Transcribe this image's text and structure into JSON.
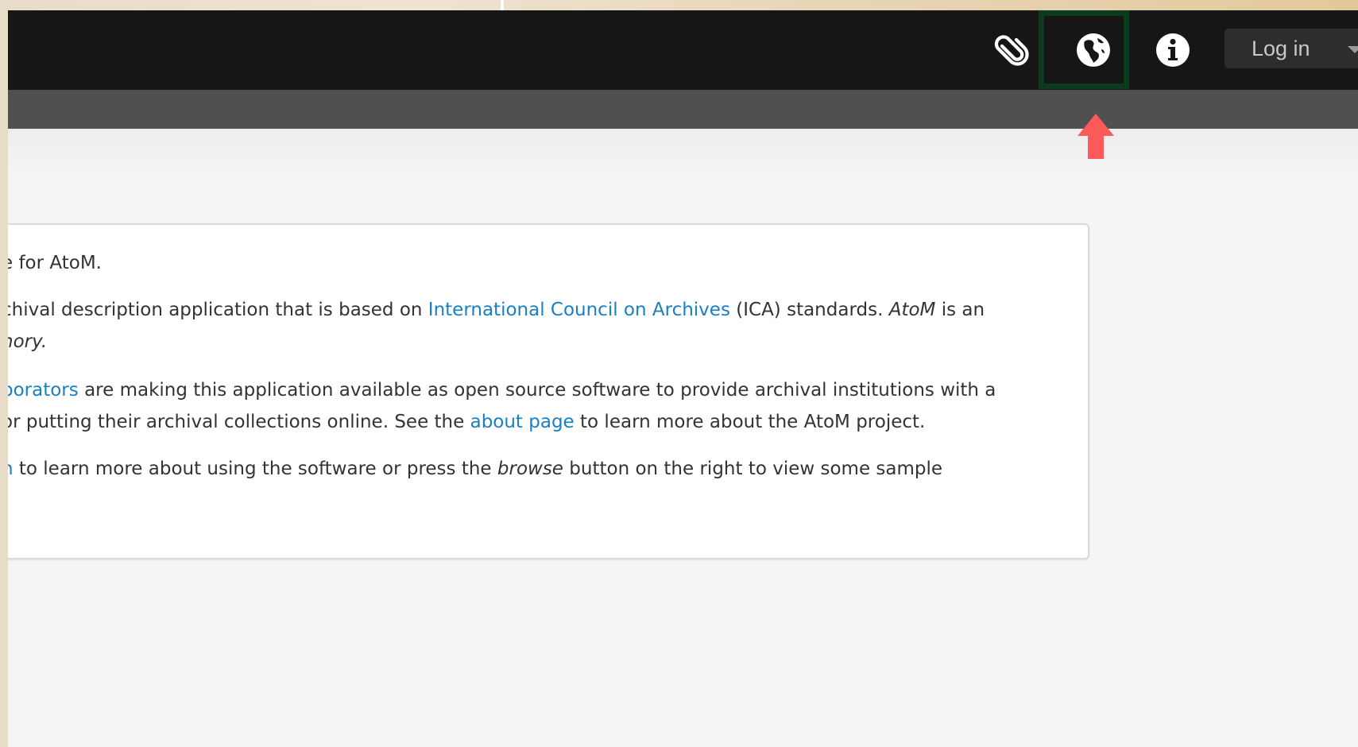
{
  "header": {
    "login_label": "Log in",
    "icons": {
      "clipboard": "paperclip-icon",
      "language": "globe-icon",
      "info": "info-icon"
    },
    "highlight_color": "#0b3a1e",
    "arrow_color": "#ff5a5a"
  },
  "content": {
    "p1": {
      "text": "e for AtoM."
    },
    "p2": {
      "a": "chival description application that is based on ",
      "link": "International Council on Archives",
      "b": " (ICA) standards. ",
      "em": "AtoM",
      "c": " is an",
      "line2": "nory."
    },
    "p3": {
      "link1": "borators",
      "a": " are making this application available as open source software to provide archival institutions with a",
      "b": "or putting their archival collections online. See the ",
      "link2": "about page",
      "c": " to learn more about the AtoM project."
    },
    "p4": {
      "link": "n",
      "a": " to learn more about using the software or press the ",
      "em": "browse",
      "b": " button on the right to view some sample"
    }
  },
  "colors": {
    "topbar": "#161616",
    "subbar": "#505050",
    "link": "#1a7fc4",
    "text": "#333333"
  }
}
